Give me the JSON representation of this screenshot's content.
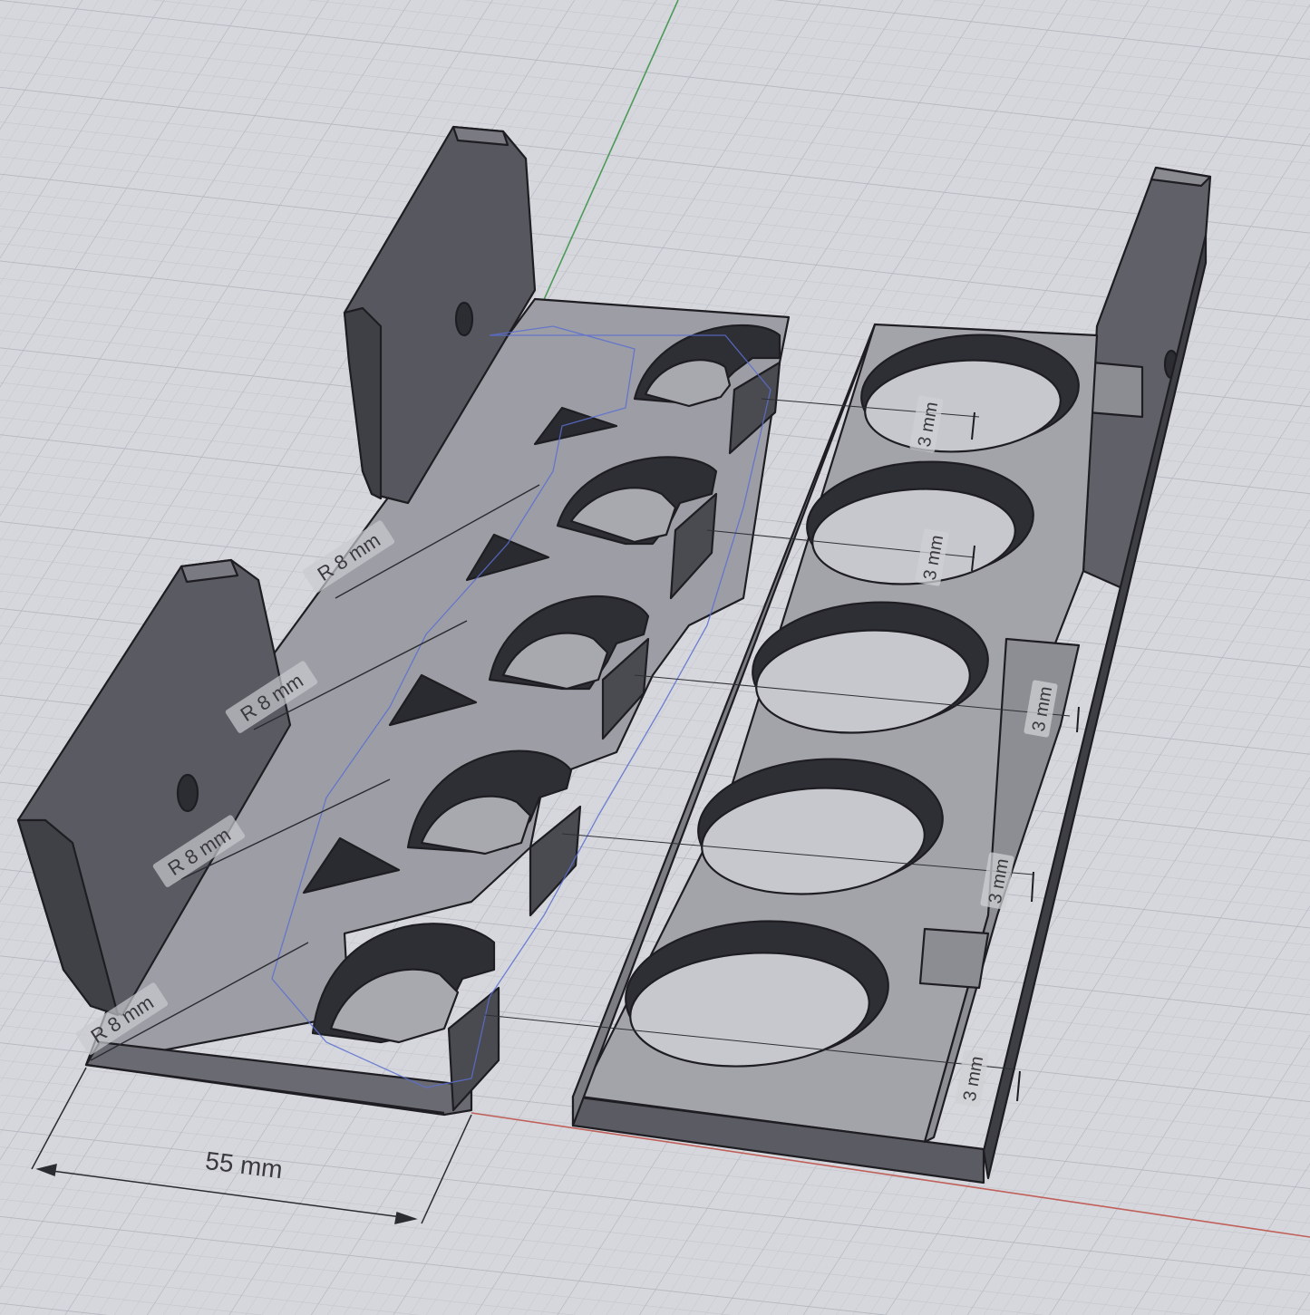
{
  "viewport": {
    "background_color": "#d6d7dc",
    "grid_color": "#b9bbc4",
    "part_face_color": "#8e8f96",
    "part_top_color": "#a7a8ae",
    "part_dark_color": "#505158",
    "edge_color": "#1d1d22",
    "axis_green_color": "#4c9a5a",
    "axis_red_color": "#c0605a",
    "sketch_blue_color": "#5a6fd0"
  },
  "dimensions": {
    "width_label": "55 mm",
    "radius_labels": [
      "R 8 mm",
      "R 8 mm",
      "R 8 mm",
      "R 8 mm"
    ],
    "thickness_labels": [
      "3 mm",
      "3 mm",
      "3 mm",
      "3 mm",
      "3 mm"
    ]
  }
}
